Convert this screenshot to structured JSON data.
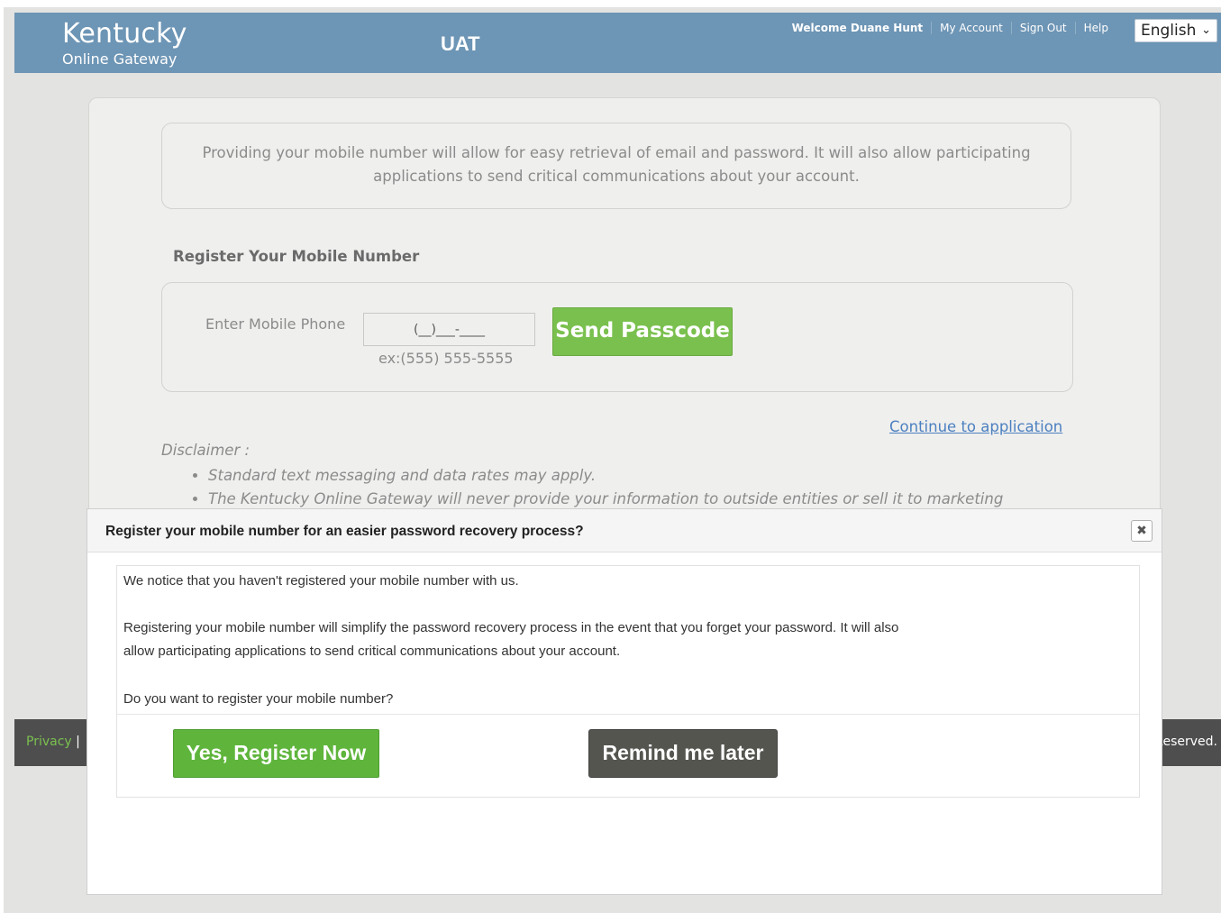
{
  "header": {
    "logo_title": "Kentucky",
    "logo_subtitle": "Online Gateway",
    "environment": "UAT",
    "nav": {
      "welcome": "Welcome Duane Hunt",
      "my_account": "My Account",
      "sign_out": "Sign Out",
      "help": "Help"
    },
    "language": "English"
  },
  "page": {
    "info_text": "Providing your mobile number will allow for easy retrieval of email and password. It will also allow participating applications to send critical communications about your account.",
    "section_title": "Register Your Mobile Number",
    "phone_label": "Enter Mobile Phone",
    "phone_placeholder": "(__)___-____",
    "phone_example": "ex:(555) 555-5555",
    "send_button": "Send Passcode",
    "continue_link": "Continue to application",
    "disclaimer_title": "Disclaimer :",
    "disclaimer_items": [
      "Standard text messaging and data rates may apply.",
      "The Kentucky Online Gateway will never provide your information to outside entities or sell it to marketing"
    ]
  },
  "footer": {
    "privacy": "Privacy",
    "separator": "|",
    "rights": "Reserved."
  },
  "modal": {
    "title": "Register your mobile number for an easier password recovery process?",
    "close": "✖",
    "line1": "We notice that you haven't registered your mobile number with us.",
    "line2a": "Registering your mobile number will simplify the password recovery process in the event that you forget your password. It will also",
    "line2b": "allow participating applications to send critical communications about your account.",
    "line3": "Do you want to register your mobile number?",
    "yes_button": "Yes, Register Now",
    "later_button": "Remind me later"
  },
  "colors": {
    "header_blue": "#6d95b5",
    "send_green": "#7ac04e",
    "yes_green": "#5fb53c",
    "later_gray": "#555550",
    "link_blue": "#4c80c0"
  }
}
